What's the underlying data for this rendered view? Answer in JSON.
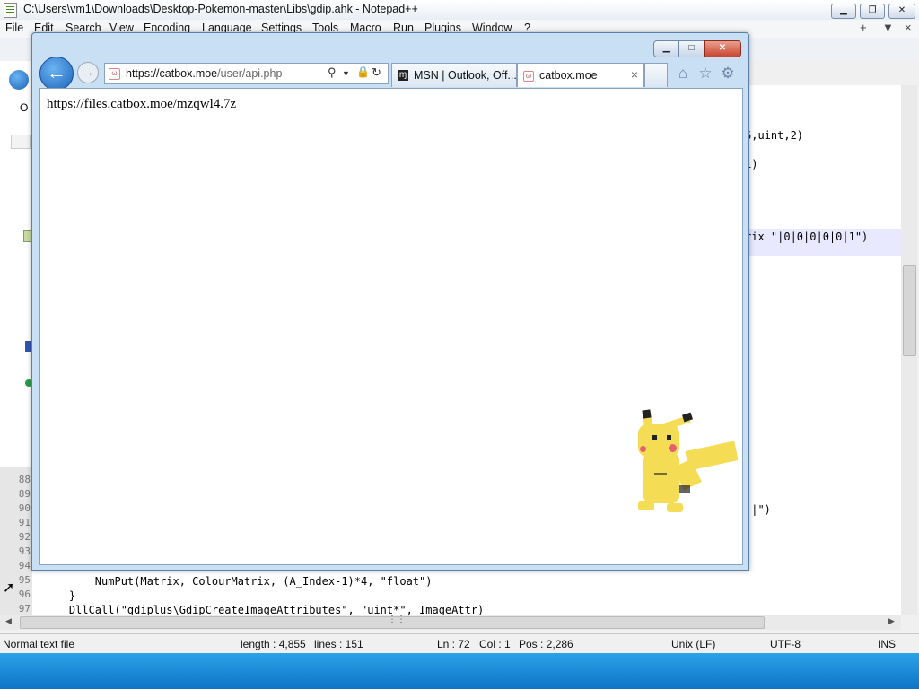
{
  "notepadpp": {
    "title": "C:\\Users\\vm1\\Downloads\\Desktop-Pokemon-master\\Libs\\gdip.ahk - Notepad++",
    "menu": [
      "File",
      "Edit",
      "Search",
      "View",
      "Encoding",
      "Language",
      "Settings",
      "Tools",
      "Macro",
      "Run",
      "Plugins",
      "Window",
      "?"
    ],
    "menu_right": [
      "+",
      "▼",
      "×"
    ],
    "visible_code_fragments": {
      "frag1": "6,uint,2)",
      "frag2": "1)",
      "frag3": "rix \"|0|0|0|0|0|1\")",
      "frag4": "'|\")"
    },
    "code_lines": [
      {
        "num": "88",
        "text": ""
      },
      {
        "num": "89",
        "text": ""
      },
      {
        "num": "90",
        "text": ""
      },
      {
        "num": "91",
        "text": ""
      },
      {
        "num": "92",
        "text": ""
      },
      {
        "num": "93",
        "text": ""
      },
      {
        "num": "94",
        "text": ""
      },
      {
        "num": "95",
        "text": "        NumPut(Matrix, ColourMatrix, (A_Index-1)*4, \"float\")"
      },
      {
        "num": "96",
        "text": "    }"
      },
      {
        "num": "97",
        "text": "    DllCall(\"gdiplus\\GdipCreateImageAttributes\", \"uint*\", ImageAttr)"
      }
    ],
    "status": {
      "filetype": "Normal text file",
      "length": "length : 4,855",
      "lines": "lines : 151",
      "ln": "Ln : 72",
      "col": "Col : 1",
      "pos": "Pos : 2,286",
      "eol": "Unix (LF)",
      "encoding": "UTF-8",
      "mode": "INS"
    }
  },
  "browser": {
    "address": {
      "host": "https://catbox.moe",
      "path": "/user/api.php"
    },
    "tabs": [
      {
        "label": "MSN | Outlook, Off...",
        "icon": "msn-icon"
      },
      {
        "label": "catbox.moe",
        "icon": "catbox-icon",
        "close": "×"
      }
    ],
    "page_text": "https://files.catbox.moe/mzqwl4.7z",
    "caption_buttons": [
      "minimize",
      "maximize",
      "close"
    ]
  },
  "colors": {
    "taskbar": "#1f8fd8",
    "ie_frame": "#c9dff3",
    "back_button": "#1d63b8"
  }
}
